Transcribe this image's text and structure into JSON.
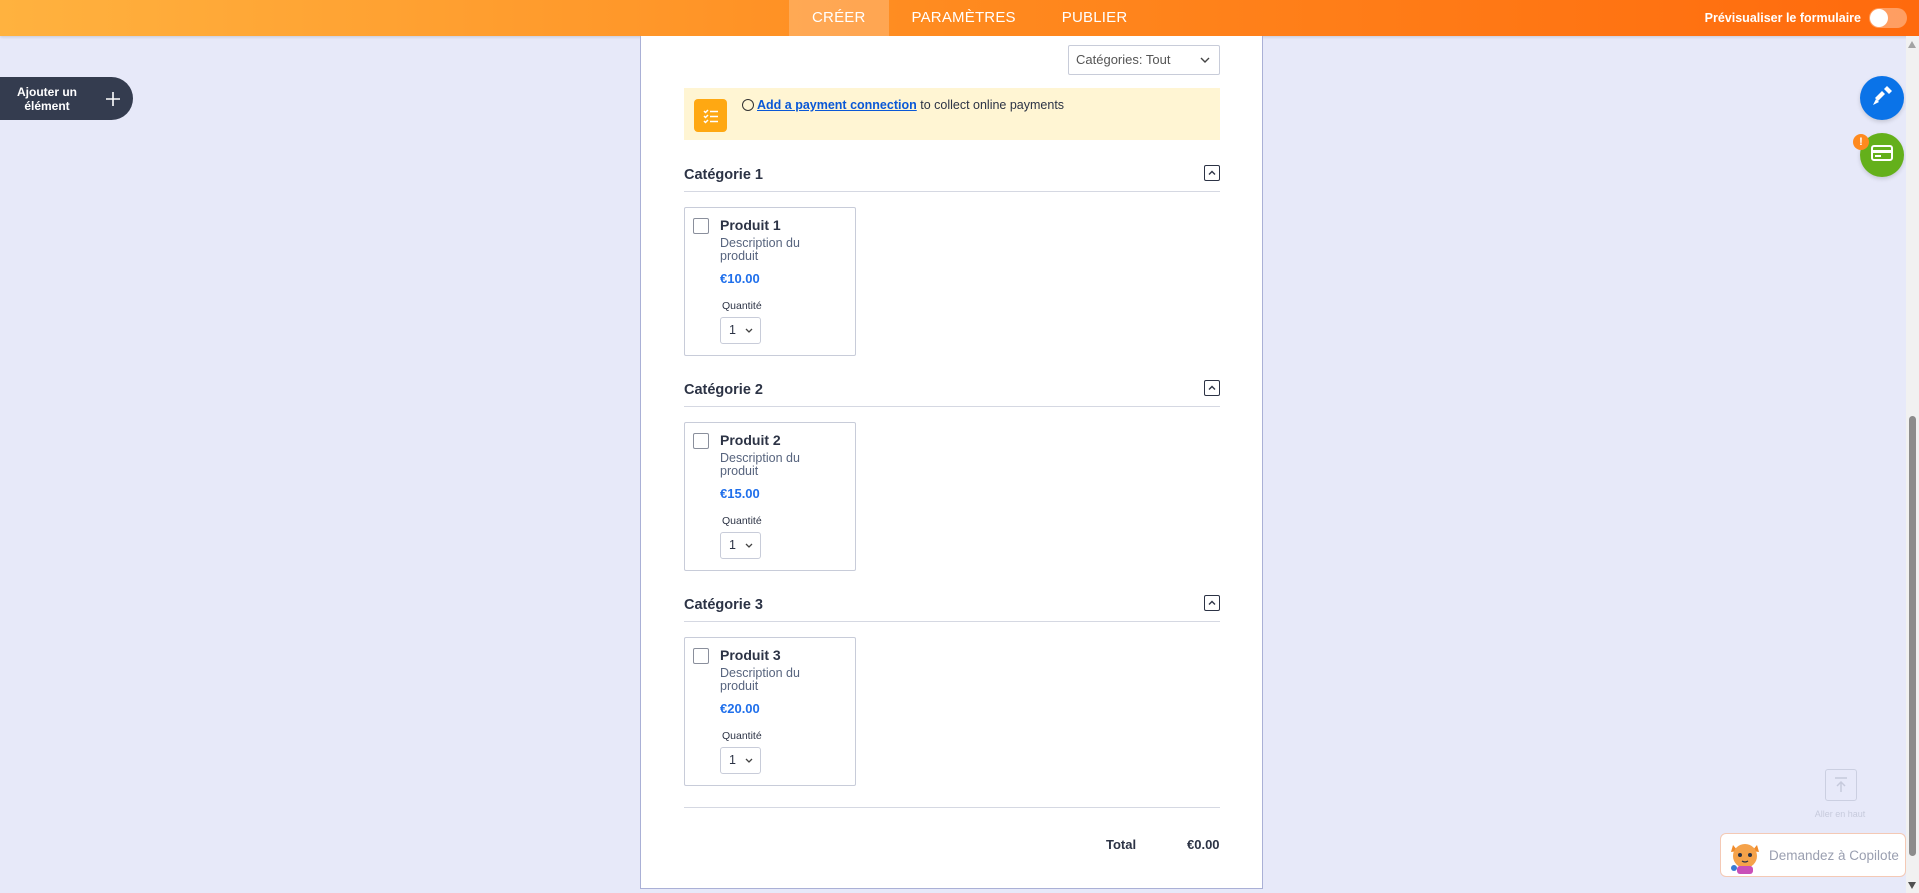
{
  "topbar": {
    "tabs": [
      {
        "label": "CRÉER",
        "active": true
      },
      {
        "label": "PARAMÈTRES",
        "active": false
      },
      {
        "label": "PUBLIER",
        "active": false
      }
    ],
    "preview_label": "Prévisualiser le formulaire",
    "preview_toggle_on": false
  },
  "sidebar": {
    "add_element_line1": "Ajouter un",
    "add_element_line2": "élément",
    "add_icon": "plus-icon"
  },
  "form": {
    "category_filter": "Catégories: Tout",
    "payment": {
      "link_text": "Add a payment connection",
      "rest_text": " to collect online payments"
    },
    "categories": [
      {
        "title": "Catégorie 1",
        "product": {
          "name": "Produit 1",
          "description": "Description du produit",
          "price": "€10.00",
          "quantity_label": "Quantité",
          "quantity": "1"
        }
      },
      {
        "title": "Catégorie 2",
        "product": {
          "name": "Produit 2",
          "description": "Description du produit",
          "price": "€15.00",
          "quantity_label": "Quantité",
          "quantity": "1"
        }
      },
      {
        "title": "Catégorie 3",
        "product": {
          "name": "Produit 3",
          "description": "Description du produit",
          "price": "€20.00",
          "quantity_label": "Quantité",
          "quantity": "1"
        }
      }
    ],
    "total_label": "Total",
    "total_value": "€0.00"
  },
  "side_buttons": {
    "warning_badge": "!"
  },
  "to_top": {
    "label": "Aller en haut"
  },
  "copilot": {
    "label": "Demandez à Copilote"
  },
  "colors": {
    "accent_orange": "#ff8a1f",
    "price_blue": "#1f6feb",
    "designer_blue": "#0a73e8",
    "payment_green": "#64b01b",
    "payment_banner": "#fff5d3"
  }
}
